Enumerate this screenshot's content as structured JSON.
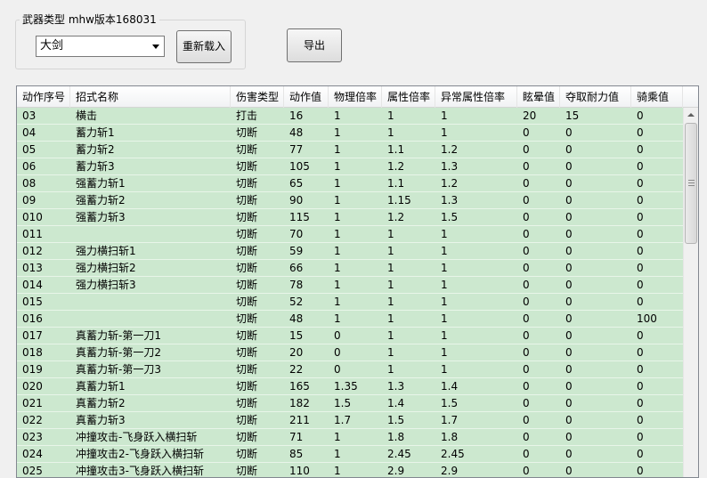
{
  "group": {
    "title": "武器类型 mhw版本168031"
  },
  "weapon_combo": {
    "selected": "大剑"
  },
  "buttons": {
    "reload": "重新载入",
    "export": "导出"
  },
  "table": {
    "columns": [
      "动作序号",
      "招式名称",
      "伤害类型",
      "动作值",
      "物理倍率",
      "属性倍率",
      "异常属性倍率",
      "眩晕值",
      "夺取耐力值",
      "骑乘值"
    ],
    "rows": [
      [
        "03",
        "横击",
        "打击",
        "16",
        "1",
        "1",
        "1",
        "20",
        "15",
        "0"
      ],
      [
        "04",
        "蓄力斩1",
        "切断",
        "48",
        "1",
        "1",
        "1",
        "0",
        "0",
        "0"
      ],
      [
        "05",
        "蓄力斩2",
        "切断",
        "77",
        "1",
        "1.1",
        "1.2",
        "0",
        "0",
        "0"
      ],
      [
        "06",
        "蓄力斩3",
        "切断",
        "105",
        "1",
        "1.2",
        "1.3",
        "0",
        "0",
        "0"
      ],
      [
        "08",
        "强蓄力斩1",
        "切断",
        "65",
        "1",
        "1.1",
        "1.2",
        "0",
        "0",
        "0"
      ],
      [
        "09",
        "强蓄力斩2",
        "切断",
        "90",
        "1",
        "1.15",
        "1.3",
        "0",
        "0",
        "0"
      ],
      [
        "010",
        "强蓄力斩3",
        "切断",
        "115",
        "1",
        "1.2",
        "1.5",
        "0",
        "0",
        "0"
      ],
      [
        "011",
        "",
        "切断",
        "70",
        "1",
        "1",
        "1",
        "0",
        "0",
        "0"
      ],
      [
        "012",
        "强力横扫斩1",
        "切断",
        "59",
        "1",
        "1",
        "1",
        "0",
        "0",
        "0"
      ],
      [
        "013",
        "强力横扫斩2",
        "切断",
        "66",
        "1",
        "1",
        "1",
        "0",
        "0",
        "0"
      ],
      [
        "014",
        "强力横扫斩3",
        "切断",
        "78",
        "1",
        "1",
        "1",
        "0",
        "0",
        "0"
      ],
      [
        "015",
        "",
        "切断",
        "52",
        "1",
        "1",
        "1",
        "0",
        "0",
        "0"
      ],
      [
        "016",
        "",
        "切断",
        "48",
        "1",
        "1",
        "1",
        "0",
        "0",
        "100"
      ],
      [
        "017",
        "真蓄力斩-第一刀1",
        "切断",
        "15",
        "0",
        "1",
        "1",
        "0",
        "0",
        "0"
      ],
      [
        "018",
        "真蓄力斩-第一刀2",
        "切断",
        "20",
        "0",
        "1",
        "1",
        "0",
        "0",
        "0"
      ],
      [
        "019",
        "真蓄力斩-第一刀3",
        "切断",
        "22",
        "0",
        "1",
        "1",
        "0",
        "0",
        "0"
      ],
      [
        "020",
        "真蓄力斩1",
        "切断",
        "165",
        "1.35",
        "1.3",
        "1.4",
        "0",
        "0",
        "0"
      ],
      [
        "021",
        "真蓄力斩2",
        "切断",
        "182",
        "1.5",
        "1.4",
        "1.5",
        "0",
        "0",
        "0"
      ],
      [
        "022",
        "真蓄力斩3",
        "切断",
        "211",
        "1.7",
        "1.5",
        "1.7",
        "0",
        "0",
        "0"
      ],
      [
        "023",
        "冲撞攻击-飞身跃入横扫斩",
        "切断",
        "71",
        "1",
        "1.8",
        "1.8",
        "0",
        "0",
        "0"
      ],
      [
        "024",
        "冲撞攻击2-飞身跃入横扫斩",
        "切断",
        "85",
        "1",
        "2.45",
        "2.45",
        "0",
        "0",
        "0"
      ],
      [
        "025",
        "冲撞攻击3-飞身跃入横扫斩",
        "切断",
        "110",
        "1",
        "2.9",
        "2.9",
        "0",
        "0",
        "0"
      ]
    ]
  },
  "colors": {
    "row_bg": "#cce8cf",
    "window_bg": "#f0f0f0"
  },
  "icons": {
    "combo_arrow": "chevron-down-icon",
    "scroll_up": "arrow-up-icon"
  }
}
